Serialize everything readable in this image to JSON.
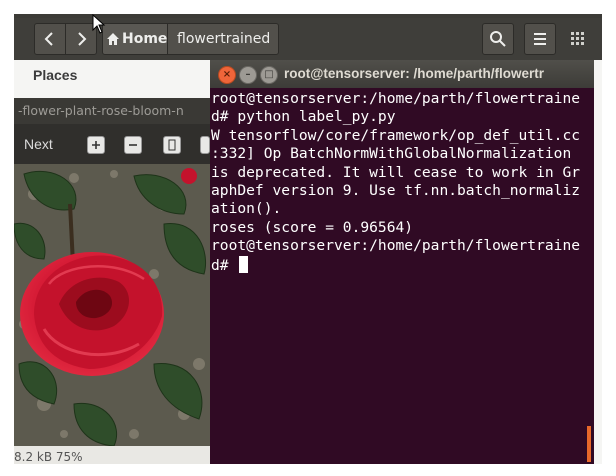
{
  "files_window": {
    "breadcrumb_home": "Home",
    "breadcrumb_folder": "flowertrained",
    "sidebar_heading": "Places"
  },
  "image_viewer": {
    "title": "-flower-plant-rose-bloom-n",
    "toolbar_next": "Next",
    "status": "8.2 kB   75%"
  },
  "terminal": {
    "title": "root@tensorserver: /home/parth/flowertr",
    "lines": "root@tensorserver:/home/parth/flowertraine\nd# python label_py.py\nW tensorflow/core/framework/op_def_util.cc\n:332] Op BatchNormWithGlobalNormalization\nis deprecated. It will cease to work in Gr\naphDef version 9. Use tf.nn.batch_normaliz\nation().\nroses (score = 0.96564)\nroot@tensorserver:/home/parth/flowertraine\nd# ",
    "close_glyph": "×",
    "min_glyph": "–",
    "max_glyph": "□"
  },
  "colors": {
    "terminal_bg": "#300a24",
    "close_button": "#f0653a",
    "toolbar": "#3f3e3a",
    "rose": "#c8102e"
  },
  "icons": [
    "back-icon",
    "forward-icon",
    "home-icon",
    "search-icon",
    "menu-icon",
    "grid-icon",
    "zoom-in-icon",
    "zoom-out-icon",
    "rotate-icon",
    "mouse-pointer-icon"
  ]
}
